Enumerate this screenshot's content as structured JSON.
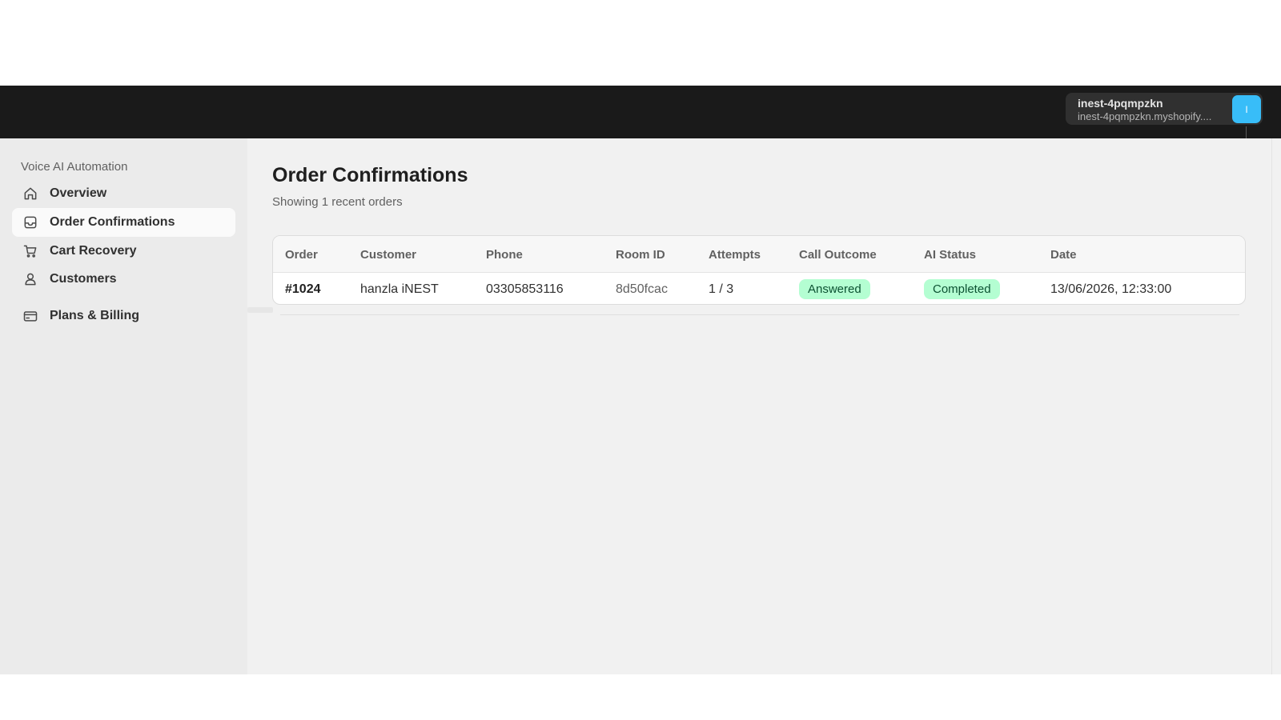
{
  "store": {
    "name": "inest-4pqmpzkn",
    "domain": "inest-4pqmpzkn.myshopify....",
    "avatar_initial": "I",
    "avatar_color": "#38bdf8"
  },
  "sidebar": {
    "section_title": "Voice AI Automation",
    "items": [
      {
        "label": "Overview",
        "icon": "home-icon",
        "active": false
      },
      {
        "label": "Order Confirmations",
        "icon": "inbox-icon",
        "active": true
      },
      {
        "label": "Cart Recovery",
        "icon": "cart-icon",
        "active": false
      },
      {
        "label": "Customers",
        "icon": "person-icon",
        "active": false
      },
      {
        "label": "Plans & Billing",
        "icon": "credit-card-icon",
        "active": false
      }
    ]
  },
  "main": {
    "title": "Order Confirmations",
    "subtitle": "Showing 1 recent orders"
  },
  "table": {
    "columns": [
      "Order",
      "Customer",
      "Phone",
      "Room ID",
      "Attempts",
      "Call Outcome",
      "AI Status",
      "Date"
    ],
    "rows": [
      {
        "order": "#1024",
        "customer": "hanzla iNEST",
        "phone": "03305853116",
        "room_id": "8d50fcac",
        "attempts": "1 / 3",
        "call_outcome": "Answered",
        "ai_status": "Completed",
        "date": "13/06/2026, 12:33:00"
      }
    ]
  },
  "colors": {
    "topbar": "#1a1a1a",
    "badge_success_bg": "#b4fed2",
    "badge_success_text": "#0c5132"
  }
}
